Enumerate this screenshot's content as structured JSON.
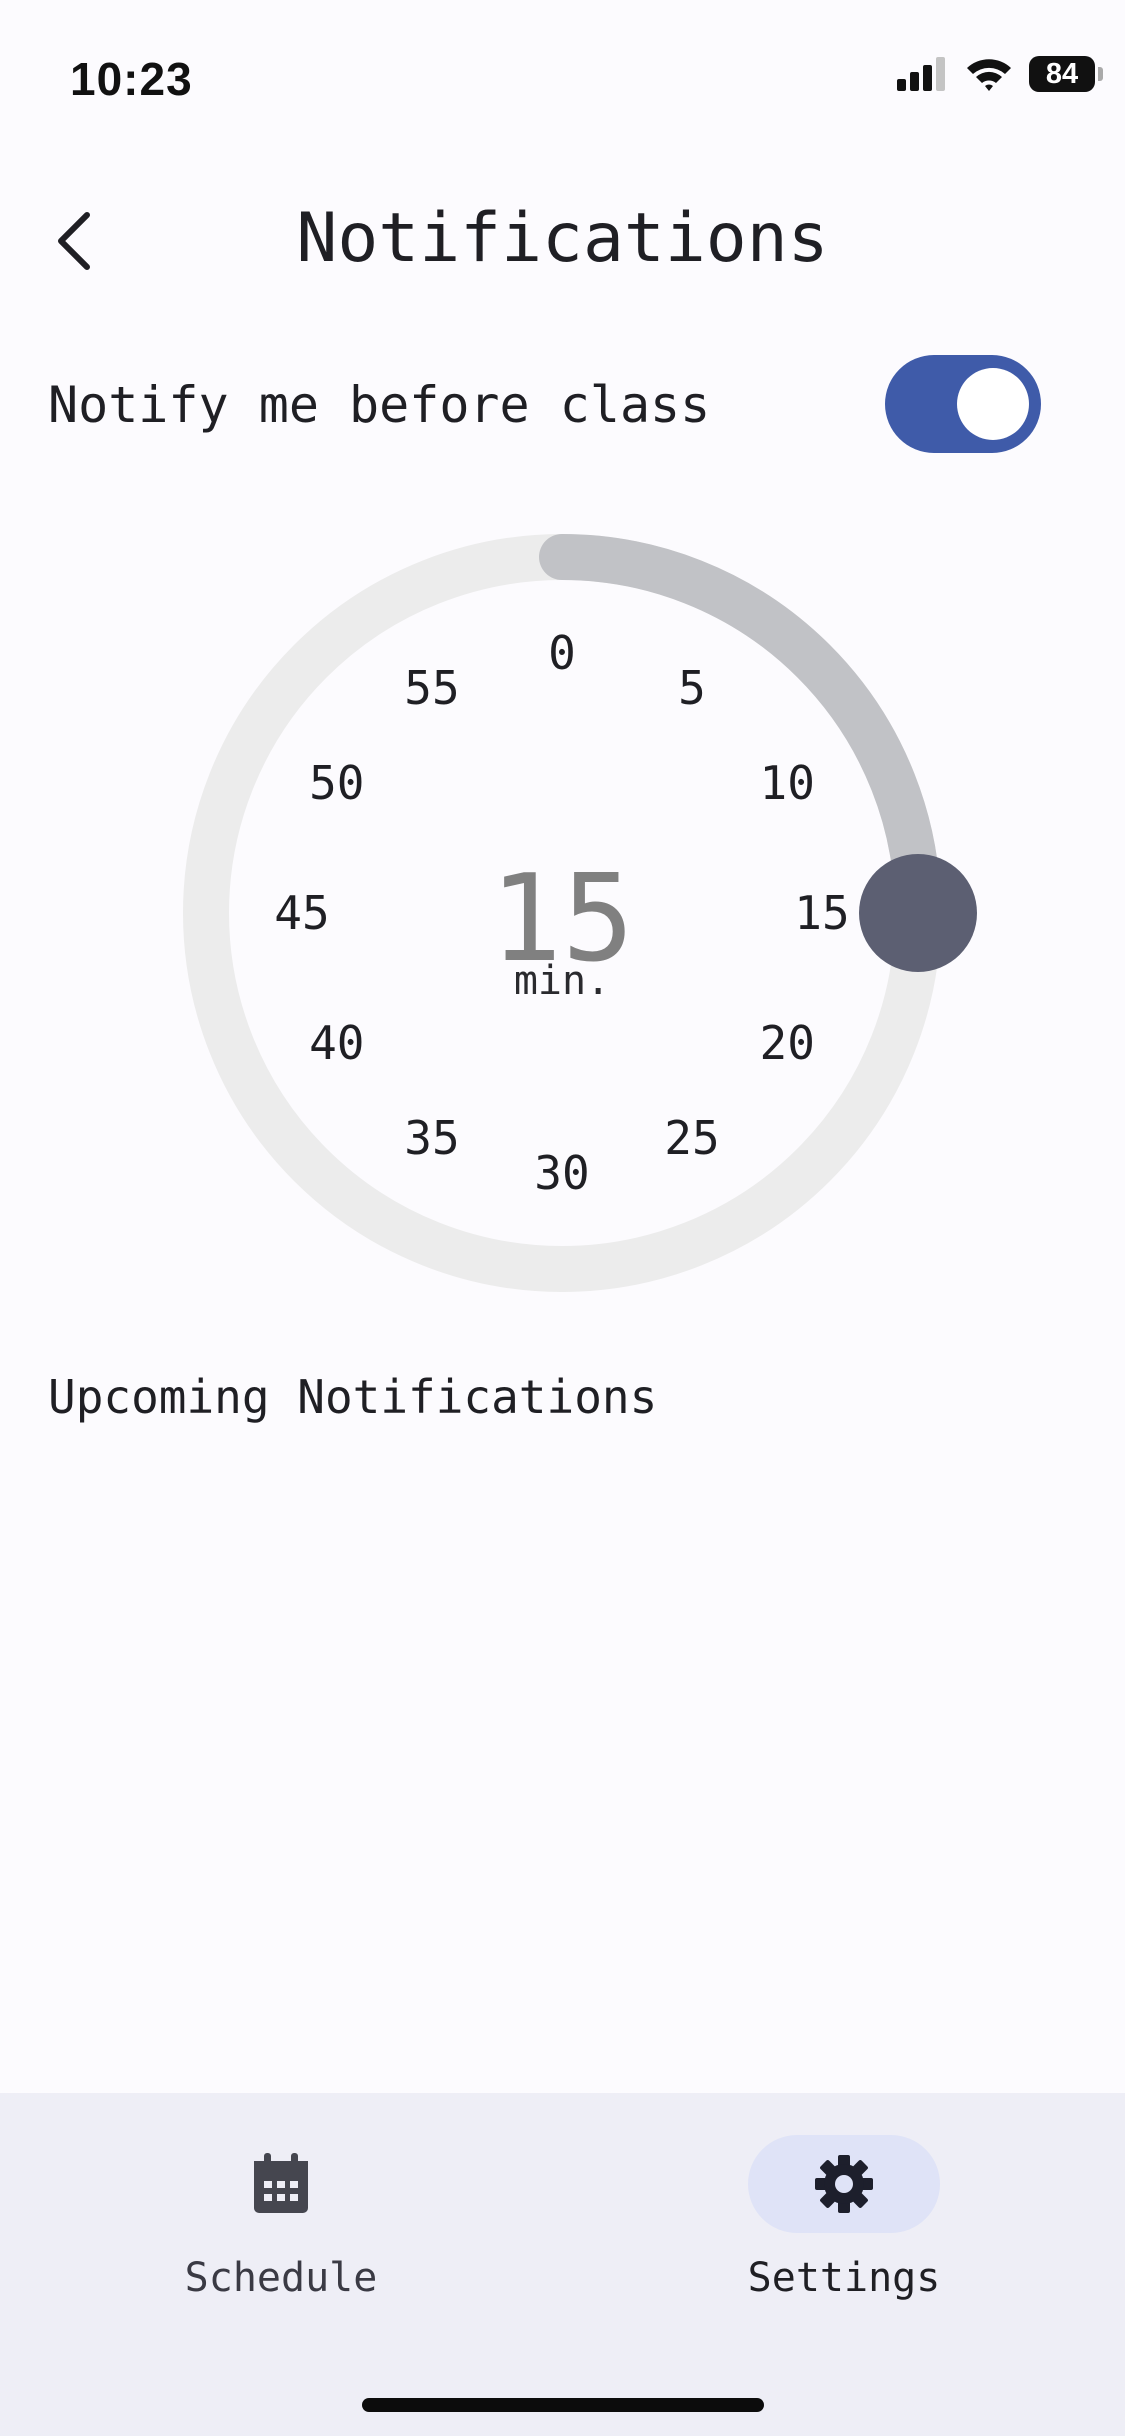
{
  "status_bar": {
    "time": "10:23",
    "battery_level": "84",
    "icons": [
      "signal-icon",
      "wifi-icon",
      "battery-icon"
    ]
  },
  "header": {
    "back_icon": "chevron-left-icon",
    "title": "Notifications"
  },
  "notify_setting": {
    "label": "Notify me before class",
    "enabled": true
  },
  "reminder_dial": {
    "ticks": [
      "0",
      "5",
      "10",
      "15",
      "20",
      "25",
      "30",
      "35",
      "40",
      "45",
      "50",
      "55"
    ],
    "selected_minutes": 15,
    "value_label": "15",
    "unit_label": "min."
  },
  "upcoming": {
    "heading": "Upcoming Notifications"
  },
  "bottom_nav": {
    "items": [
      {
        "label": "Schedule",
        "icon": "calendar-icon",
        "active": false
      },
      {
        "label": "Settings",
        "icon": "gear-icon",
        "active": true
      }
    ]
  },
  "colors": {
    "toggle_on": "#3f5ba9",
    "dial_track": "#ececec",
    "dial_progress": "#c1c2c6",
    "dial_handle": "#5c5f72",
    "nav_background": "#eeeef6",
    "active_pill": "#dfe3f7"
  }
}
